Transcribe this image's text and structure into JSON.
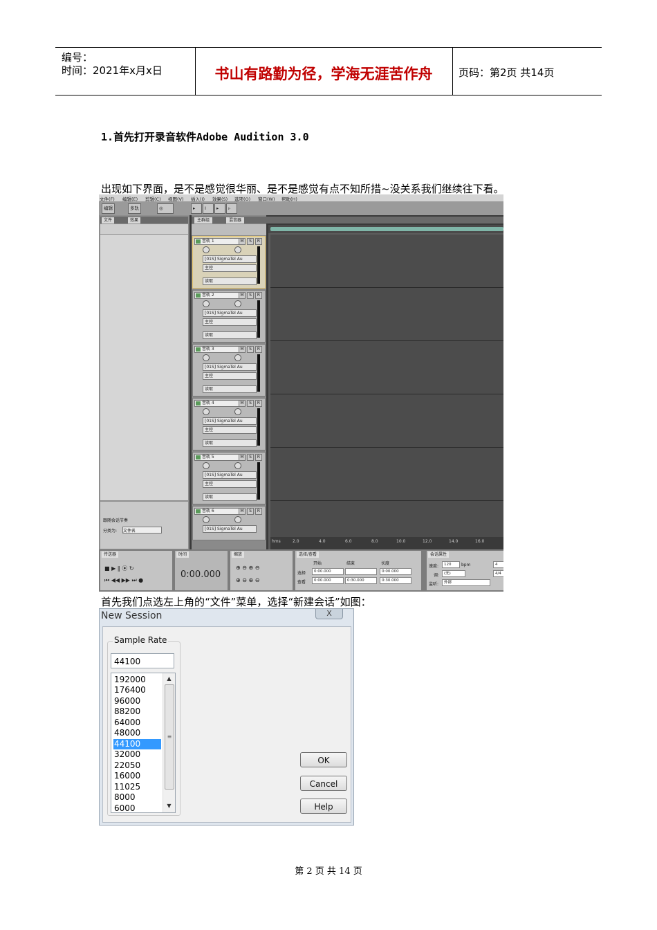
{
  "header": {
    "number_label": "编号：",
    "date_label": "时间：2021年x月x日",
    "motto": "书山有路勤为径，学海无涯苦作舟",
    "page_label": "页码：第2页  共14页"
  },
  "body": {
    "step_title": "1.首先打开录音软件Adobe Audition 3.0",
    "para1": "出现如下界面，是不是感觉很华丽、是不是感觉有点不知所措~没关系我们继续往下看。",
    "para2": "首先我们点选左上角的“文件”菜单，选择“新建会话”如图："
  },
  "audition": {
    "menu": [
      "文件(F)",
      "编辑(E)",
      "剪辑(C)",
      "视图(V)",
      "插入(I)",
      "效果(S)",
      "选项(O)",
      "窗口(W)",
      "帮助(H)"
    ],
    "mode_edit": "编辑",
    "mode_multi": "多轨",
    "left_tabs": [
      "文件",
      "效果"
    ],
    "follow_session": "跟随会话节奏",
    "sort_label": "分类为:",
    "sort_value": "文件名",
    "main_tabs": [
      "主群组",
      "混音器"
    ],
    "tracks": [
      {
        "name": "音轨 1",
        "input": "[01S] SigmaTel Au",
        "output": "主控",
        "mode": "读取"
      },
      {
        "name": "音轨 2",
        "input": "[01S] SigmaTel Au",
        "output": "主控",
        "mode": "读取"
      },
      {
        "name": "音轨 3",
        "input": "[01S] SigmaTel Au",
        "output": "主控",
        "mode": "读取"
      },
      {
        "name": "音轨 4",
        "input": "[01S] SigmaTel Au",
        "output": "主控",
        "mode": "读取"
      },
      {
        "name": "音轨 5",
        "input": "[01S] SigmaTel Au",
        "output": "主控",
        "mode": "读取"
      },
      {
        "name": "音轨 6",
        "input": "[01S] SigmaTel Au",
        "output": "",
        "mode": ""
      }
    ],
    "track_buttons": [
      "M",
      "S",
      "R"
    ],
    "knob_value": "0",
    "ruler": [
      "hms",
      "2.0",
      "4.0",
      "6.0",
      "8.0",
      "10.0",
      "12.0",
      "14.0",
      "16.0"
    ],
    "panels": {
      "transport": "传送器",
      "time": "时间",
      "zoom": "缩放",
      "selection": "选择/查看",
      "session": "会话属性"
    },
    "timecode": "0:00.000",
    "sel_headers": [
      "开始",
      "结束",
      "长度"
    ],
    "sel_row_label": "选择",
    "view_row_label": "查看",
    "sel_values": [
      "0:00.000",
      "",
      "0:00.000"
    ],
    "view_values": [
      "0:00.000",
      "0:30.000",
      "0:30.000"
    ],
    "tempo_label": "速度:",
    "tempo_value": "120",
    "tempo_unit": "bpm",
    "beats_value": "4",
    "key_label": "调:",
    "key_value": "(无)",
    "sig_value": "4/4",
    "sync_label": "监听:",
    "sync_value": "外部"
  },
  "dialog": {
    "title": "New Session",
    "close": "X",
    "group_label": "Sample Rate",
    "input_value": "44100",
    "rates": [
      "192000",
      "176400",
      "96000",
      "88200",
      "64000",
      "48000",
      "44100",
      "32000",
      "22050",
      "16000",
      "11025",
      "8000",
      "6000"
    ],
    "selected_rate": "44100",
    "ok": "OK",
    "cancel": "Cancel",
    "help": "Help"
  },
  "footer": {
    "text": "第 2 页 共 14 页"
  }
}
